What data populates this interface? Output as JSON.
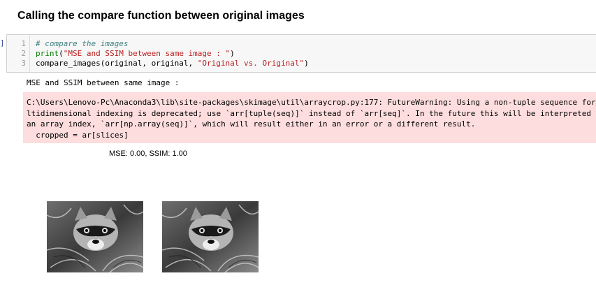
{
  "heading": "Calling the compare function between original images",
  "prompt": "]:",
  "cell": {
    "line_numbers": [
      "1",
      "2",
      "3"
    ],
    "comment": "# compare the images",
    "print_fn": "print",
    "print_arg": "\"MSE and SSIM between same image : \"",
    "compare_call": "compare_images(original, original, ",
    "compare_str": "\"Original vs. Original\""
  },
  "output": {
    "stdout": "MSE and SSIM between same image :",
    "stderr_lines": [
      "C:\\Users\\Lenovo-Pc\\Anaconda3\\lib\\site-packages\\skimage\\util\\arraycrop.py:177: FutureWarning: Using a non-tuple sequence for mu",
      "ltidimensional indexing is deprecated; use `arr[tuple(seq)]` instead of `arr[seq]`. In the future this will be interpreted as",
      "an array index, `arr[np.array(seq)]`, which will result either in an error or a different result.",
      "  cropped = ar[slices]"
    ],
    "metric": "MSE: 0.00, SSIM: 1.00"
  },
  "images": {
    "left_icon": "raccoon-photo",
    "right_icon": "raccoon-photo"
  }
}
